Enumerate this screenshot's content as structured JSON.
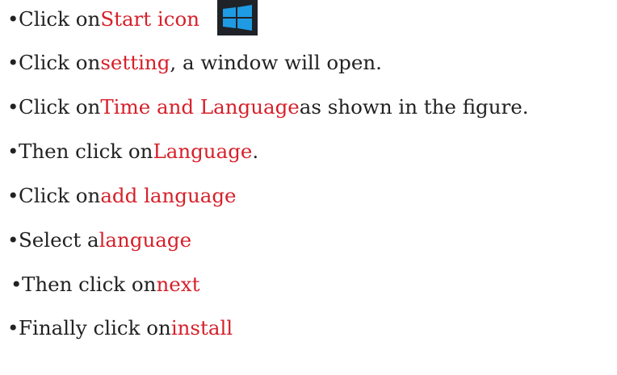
{
  "bullet": "•",
  "steps": [
    {
      "prefix": "Click on ",
      "link": "Start icon",
      "suffix": "",
      "icon": "windows-logo-icon"
    },
    {
      "prefix": "Click on ",
      "link": "setting",
      "suffix": ", a window will open."
    },
    {
      "prefix": "Click on ",
      "link": "Time and Language",
      "suffix": " as shown in the figure."
    },
    {
      "prefix": "Then click on ",
      "link": "Language",
      "suffix": "."
    },
    {
      "prefix": "Click on ",
      "link": "add language",
      "suffix": ""
    },
    {
      "prefix": "Select a ",
      "link": "language",
      "suffix": ""
    },
    {
      "prefix": " Then click on ",
      "link": "next",
      "suffix": ""
    },
    {
      "prefix": "Finally click on ",
      "link": "install",
      "suffix": ""
    }
  ],
  "colors": {
    "text": "#222222",
    "highlight": "#d6202a",
    "logo_bg": "#1f2227",
    "logo_blue": "#1e9be3"
  }
}
